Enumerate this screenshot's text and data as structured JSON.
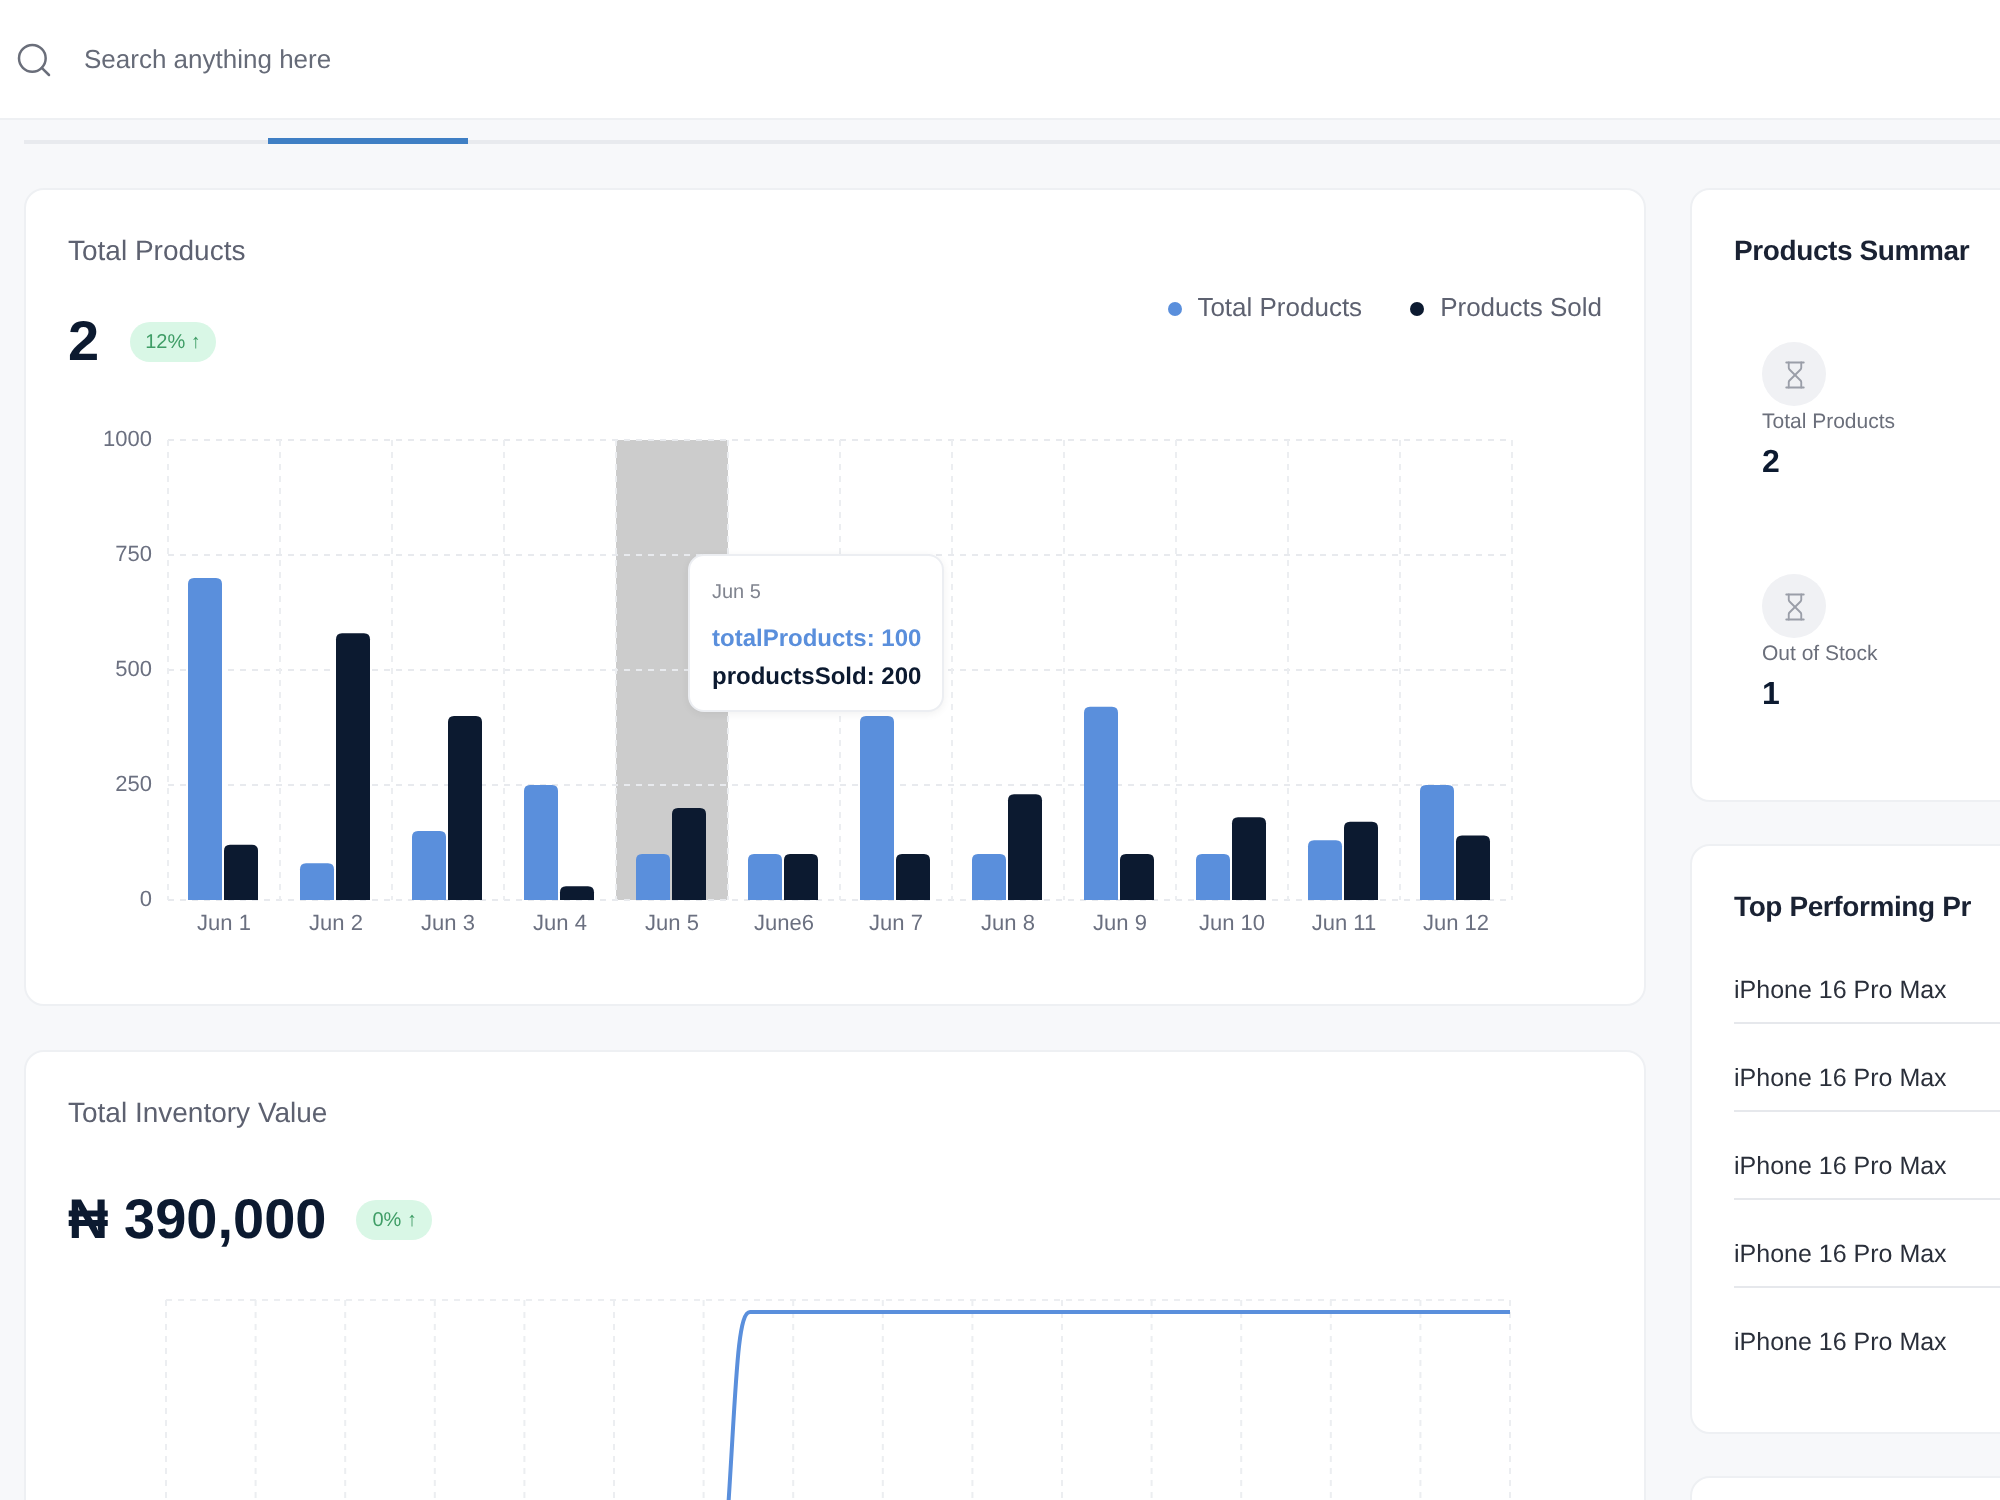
{
  "search": {
    "placeholder": "Search anything here"
  },
  "tabs": [
    {
      "selected": false
    },
    {
      "selected": true
    }
  ],
  "products_card": {
    "title": "Total Products",
    "value": "2",
    "change": "12% ↑",
    "chart_data": {
      "type": "bar",
      "categories": [
        "Jun 1",
        "Jun 2",
        "Jun 3",
        "Jun 4",
        "Jun 5",
        "June6",
        "Jun 7",
        "Jun 8",
        "Jun 9",
        "Jun 10",
        "Jun 11",
        "Jun 12"
      ],
      "series": [
        {
          "name": "Total Products",
          "color": "#5a8fdc",
          "values": [
            700,
            80,
            150,
            250,
            100,
            100,
            400,
            100,
            420,
            100,
            130,
            250
          ]
        },
        {
          "name": "Products Sold",
          "color": "#0c1a30",
          "values": [
            120,
            580,
            400,
            30,
            200,
            100,
            100,
            230,
            100,
            180,
            170,
            140
          ]
        }
      ],
      "ylim": [
        0,
        1000
      ],
      "yticks": [
        0,
        250,
        500,
        750,
        1000
      ],
      "grid": true
    },
    "tooltip": {
      "title": "Jun 5",
      "lines": [
        {
          "text": "totalProducts: 100",
          "color": "#5a8fdc"
        },
        {
          "text": "productsSold: 200",
          "color": "#0c1a30"
        }
      ]
    }
  },
  "inventory_card": {
    "title": "Total Inventory Value",
    "value": "₦ 390,000",
    "change": "0% ↑"
  },
  "summary_card": {
    "title": "Products Summar",
    "stats": [
      {
        "label": "Total Products",
        "value": "2"
      },
      {
        "label": "Out of Stock",
        "value": "1"
      }
    ]
  },
  "top_products_card": {
    "title": "Top Performing Pr",
    "items": [
      "iPhone 16 Pro Max",
      "iPhone 16 Pro Max",
      "iPhone 16 Pro Max",
      "iPhone 16 Pro Max",
      "iPhone 16 Pro Max"
    ]
  }
}
